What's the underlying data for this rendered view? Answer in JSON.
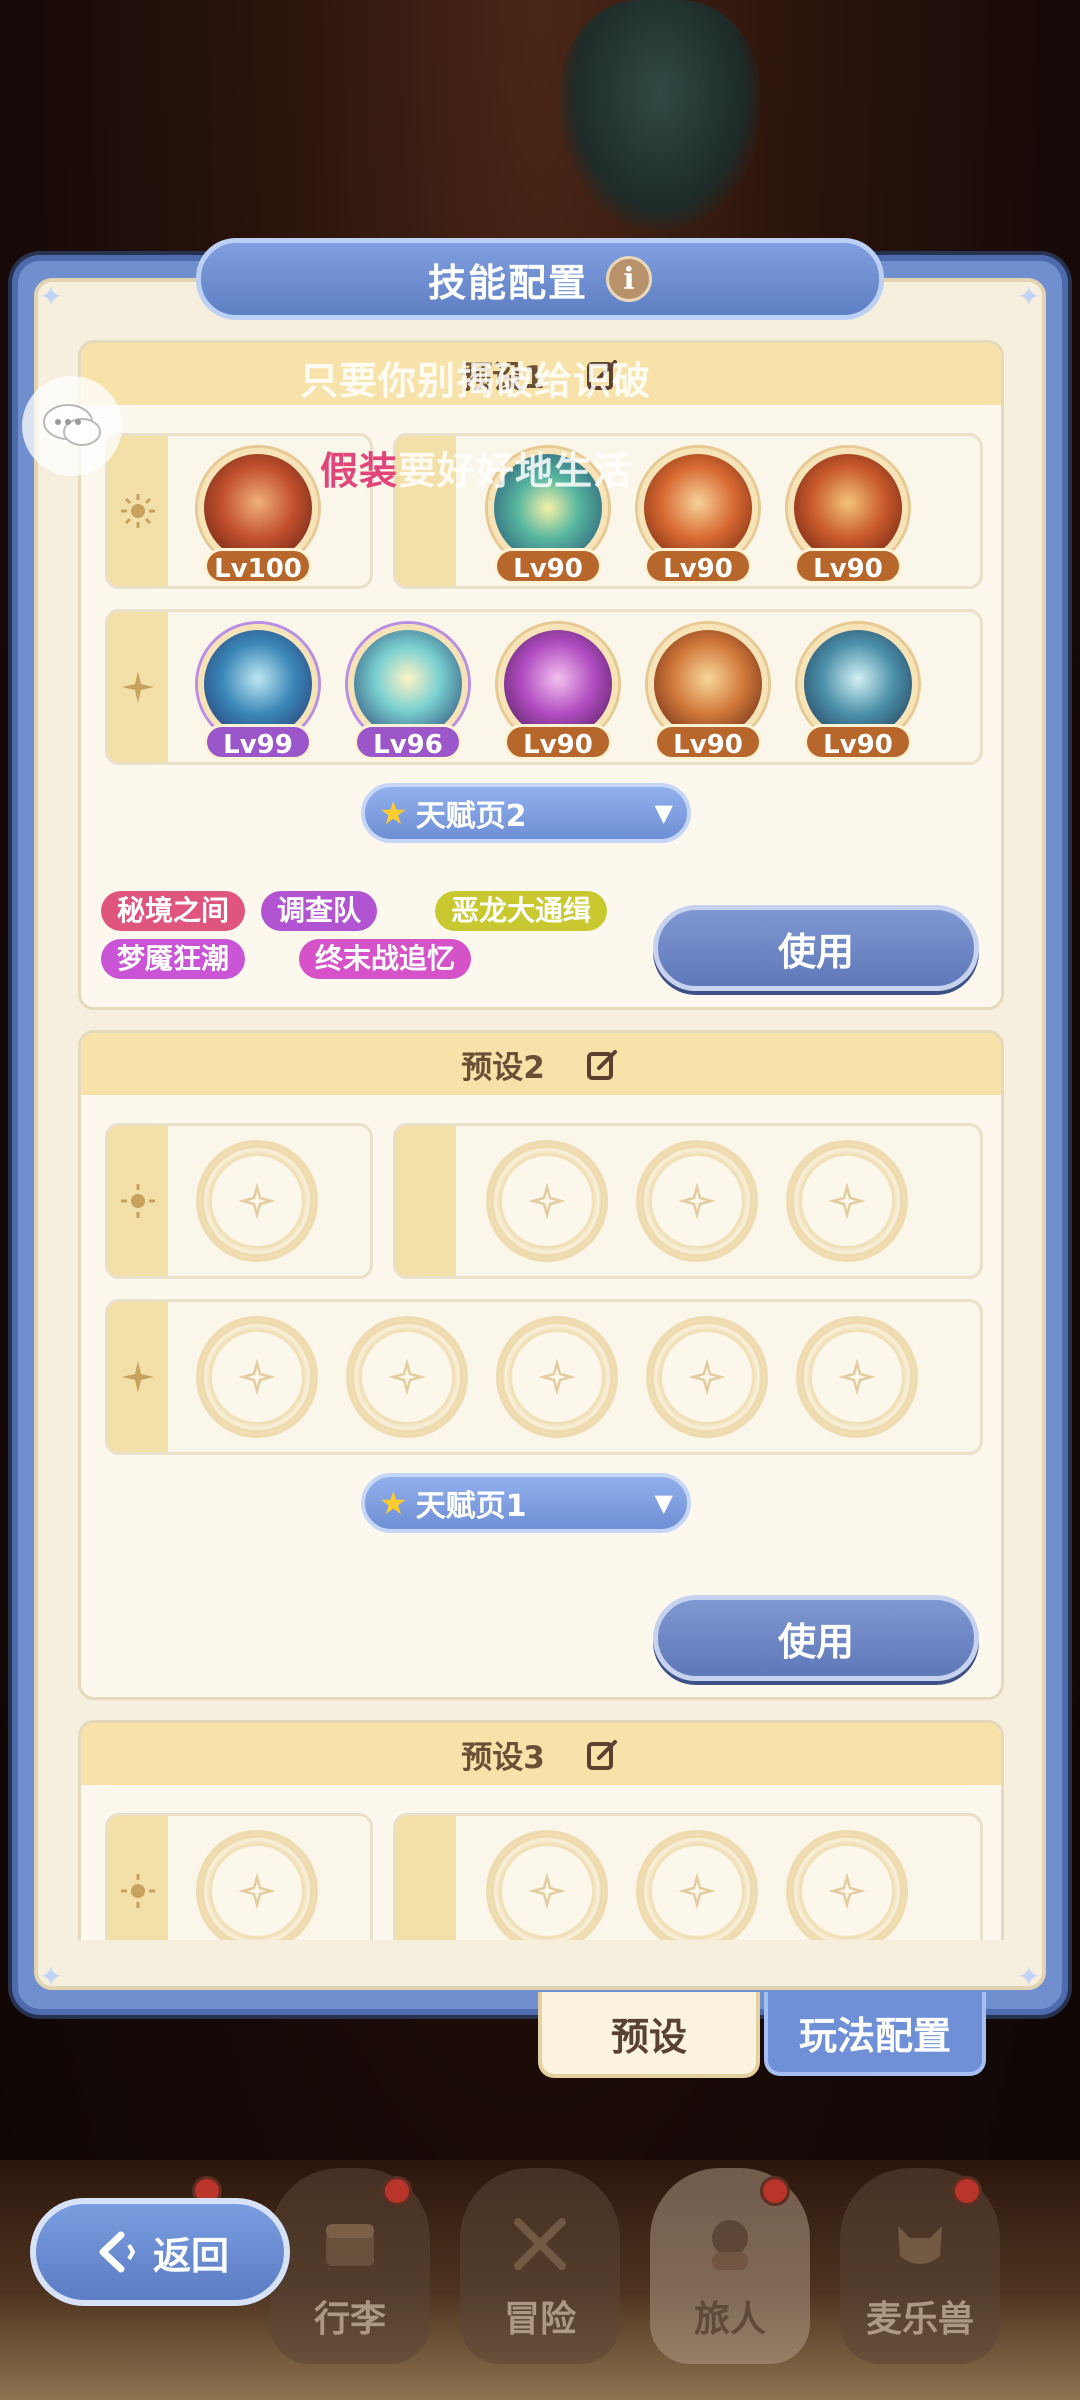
{
  "panel": {
    "title": "技能配置"
  },
  "overlay": {
    "line1": "只要你别揭破给识破",
    "line2_pink": "假装",
    "line2_rest": "要好好地生活"
  },
  "presets": [
    {
      "name": "预设1",
      "talent_page": "天赋页2",
      "use_label": "使用",
      "group_a_levels": [
        "Lv100"
      ],
      "group_b_levels": [
        "Lv90",
        "Lv90",
        "Lv90"
      ],
      "group_c_levels": [
        "Lv99",
        "Lv96",
        "Lv90",
        "Lv90",
        "Lv90"
      ],
      "tags": [
        {
          "label": "秘境之间",
          "color": "#e0557d"
        },
        {
          "label": "调查队",
          "color": "#b254d1"
        },
        {
          "label": "恶龙大通缉",
          "color": "#c8c930"
        },
        {
          "label": "梦魇狂潮",
          "color": "#c954d6"
        },
        {
          "label": "终末战追忆",
          "color": "#d552c8"
        }
      ]
    },
    {
      "name": "预设2",
      "talent_page": "天赋页1",
      "use_label": "使用"
    },
    {
      "name": "预设3"
    }
  ],
  "tabs": {
    "preset": "预设",
    "gameplay": "玩法配置"
  },
  "nav": {
    "back": "返回",
    "items": [
      "行李",
      "冒险",
      "旅人",
      "麦乐兽"
    ]
  },
  "colors": {
    "accent_blue": "#6f8fcf",
    "cream": "#f6efdd",
    "header_gold": "#f7e2a9"
  }
}
